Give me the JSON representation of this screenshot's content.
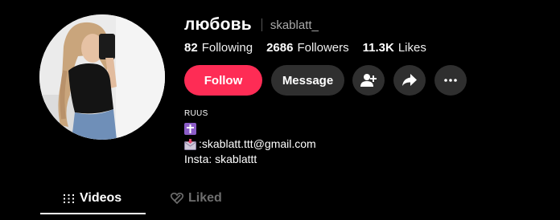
{
  "profile": {
    "display_name": "любовь",
    "username": "skablatt_"
  },
  "stats": {
    "following_count": "82",
    "following_label": "Following",
    "followers_count": "2686",
    "followers_label": "Followers",
    "likes_count": "11.3K",
    "likes_label": "Likes"
  },
  "actions": {
    "follow_label": "Follow",
    "message_label": "Message",
    "add_friend_icon": "add-user-icon",
    "share_icon": "share-arrow-icon",
    "more_icon": "more-dots-icon"
  },
  "bio": {
    "line1": "RUUS",
    "line2_emoji": "cross-emoji",
    "line3_text": ":skablatt.ttt@gmail.com",
    "line3_emoji": "envelope-emoji",
    "line4": "Insta: skablattt"
  },
  "tabs": [
    {
      "label": "Videos",
      "icon": "grid-lines-icon",
      "active": true
    },
    {
      "label": "Liked",
      "icon": "liked-heart-icon",
      "active": false
    }
  ],
  "colors": {
    "background": "#000000",
    "follow_button": "#fe2c55",
    "secondary_button": "#2f2f2f",
    "muted_text": "#a9a9a9",
    "inactive_tab": "#6e6e6e",
    "emoji_purple": "#8b5cc7"
  }
}
